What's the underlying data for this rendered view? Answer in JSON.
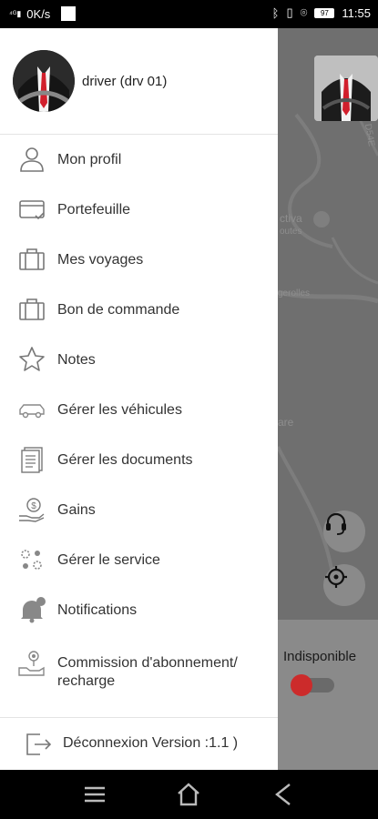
{
  "status_bar": {
    "network_speed": "0K/s",
    "battery_level": "97",
    "time": "11:55",
    "icons": [
      "signal-icon",
      "bluetooth-icon",
      "vibrate-icon",
      "location-icon",
      "battery-icon"
    ]
  },
  "drawer": {
    "driver_name": "driver (drv 01)",
    "menu": [
      {
        "label": "Mon profil",
        "icon": "user-icon"
      },
      {
        "label": "Portefeuille",
        "icon": "wallet-icon"
      },
      {
        "label": "Mes voyages",
        "icon": "briefcase-icon"
      },
      {
        "label": "Bon de commande",
        "icon": "briefcase-icon"
      },
      {
        "label": "Notes",
        "icon": "star-icon"
      },
      {
        "label": "Gérer les véhicules",
        "icon": "car-icon"
      },
      {
        "label": "Gérer les documents",
        "icon": "documents-icon"
      },
      {
        "label": "Gains",
        "icon": "earnings-icon"
      },
      {
        "label": "Gérer le service",
        "icon": "service-icon"
      },
      {
        "label": "Notifications",
        "icon": "bell-icon"
      },
      {
        "label": "Commission d'abonnement/\nrecharge",
        "icon": "subscription-icon"
      }
    ],
    "logout_label": "Déconnexion Version :1.1 )"
  },
  "map": {
    "labels": [
      "ctiva",
      "outes",
      "gerolles",
      "D54E",
      "are"
    ]
  },
  "availability": {
    "label": "Indisponible",
    "online": false
  },
  "colors": {
    "toggle_knob": "#cc2b2b",
    "tie": "#d11f2c"
  }
}
